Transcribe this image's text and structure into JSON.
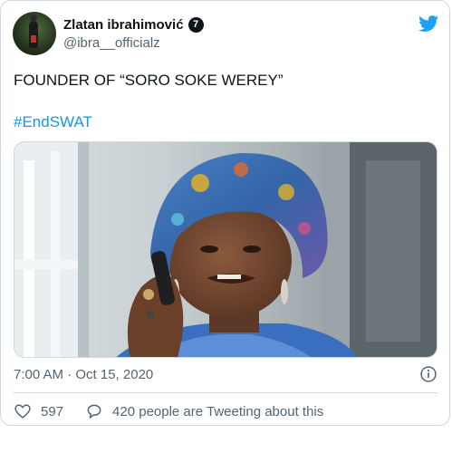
{
  "author": {
    "display_name": "Zlatan ibrahimović",
    "badge": "7",
    "handle": "@ibra__officialz"
  },
  "tweet": {
    "text": "FOUNDER OF “SORO SOKE WEREY”",
    "hashtag": "#EndSWAT",
    "timestamp": "7:00 AM · Oct 15, 2020"
  },
  "actions": {
    "likes_count": "597",
    "tweeting_text": "420 people are Tweeting about this"
  },
  "icons": {
    "brand": "twitter-bird-icon",
    "info": "info-icon",
    "like": "heart-icon",
    "reply": "speech-bubble-icon"
  },
  "colors": {
    "brand_blue": "#1da1f2",
    "hashtag_blue": "#1b95e0",
    "text_primary": "#0f1419",
    "text_secondary": "#536471",
    "border": "#cfd9de"
  }
}
